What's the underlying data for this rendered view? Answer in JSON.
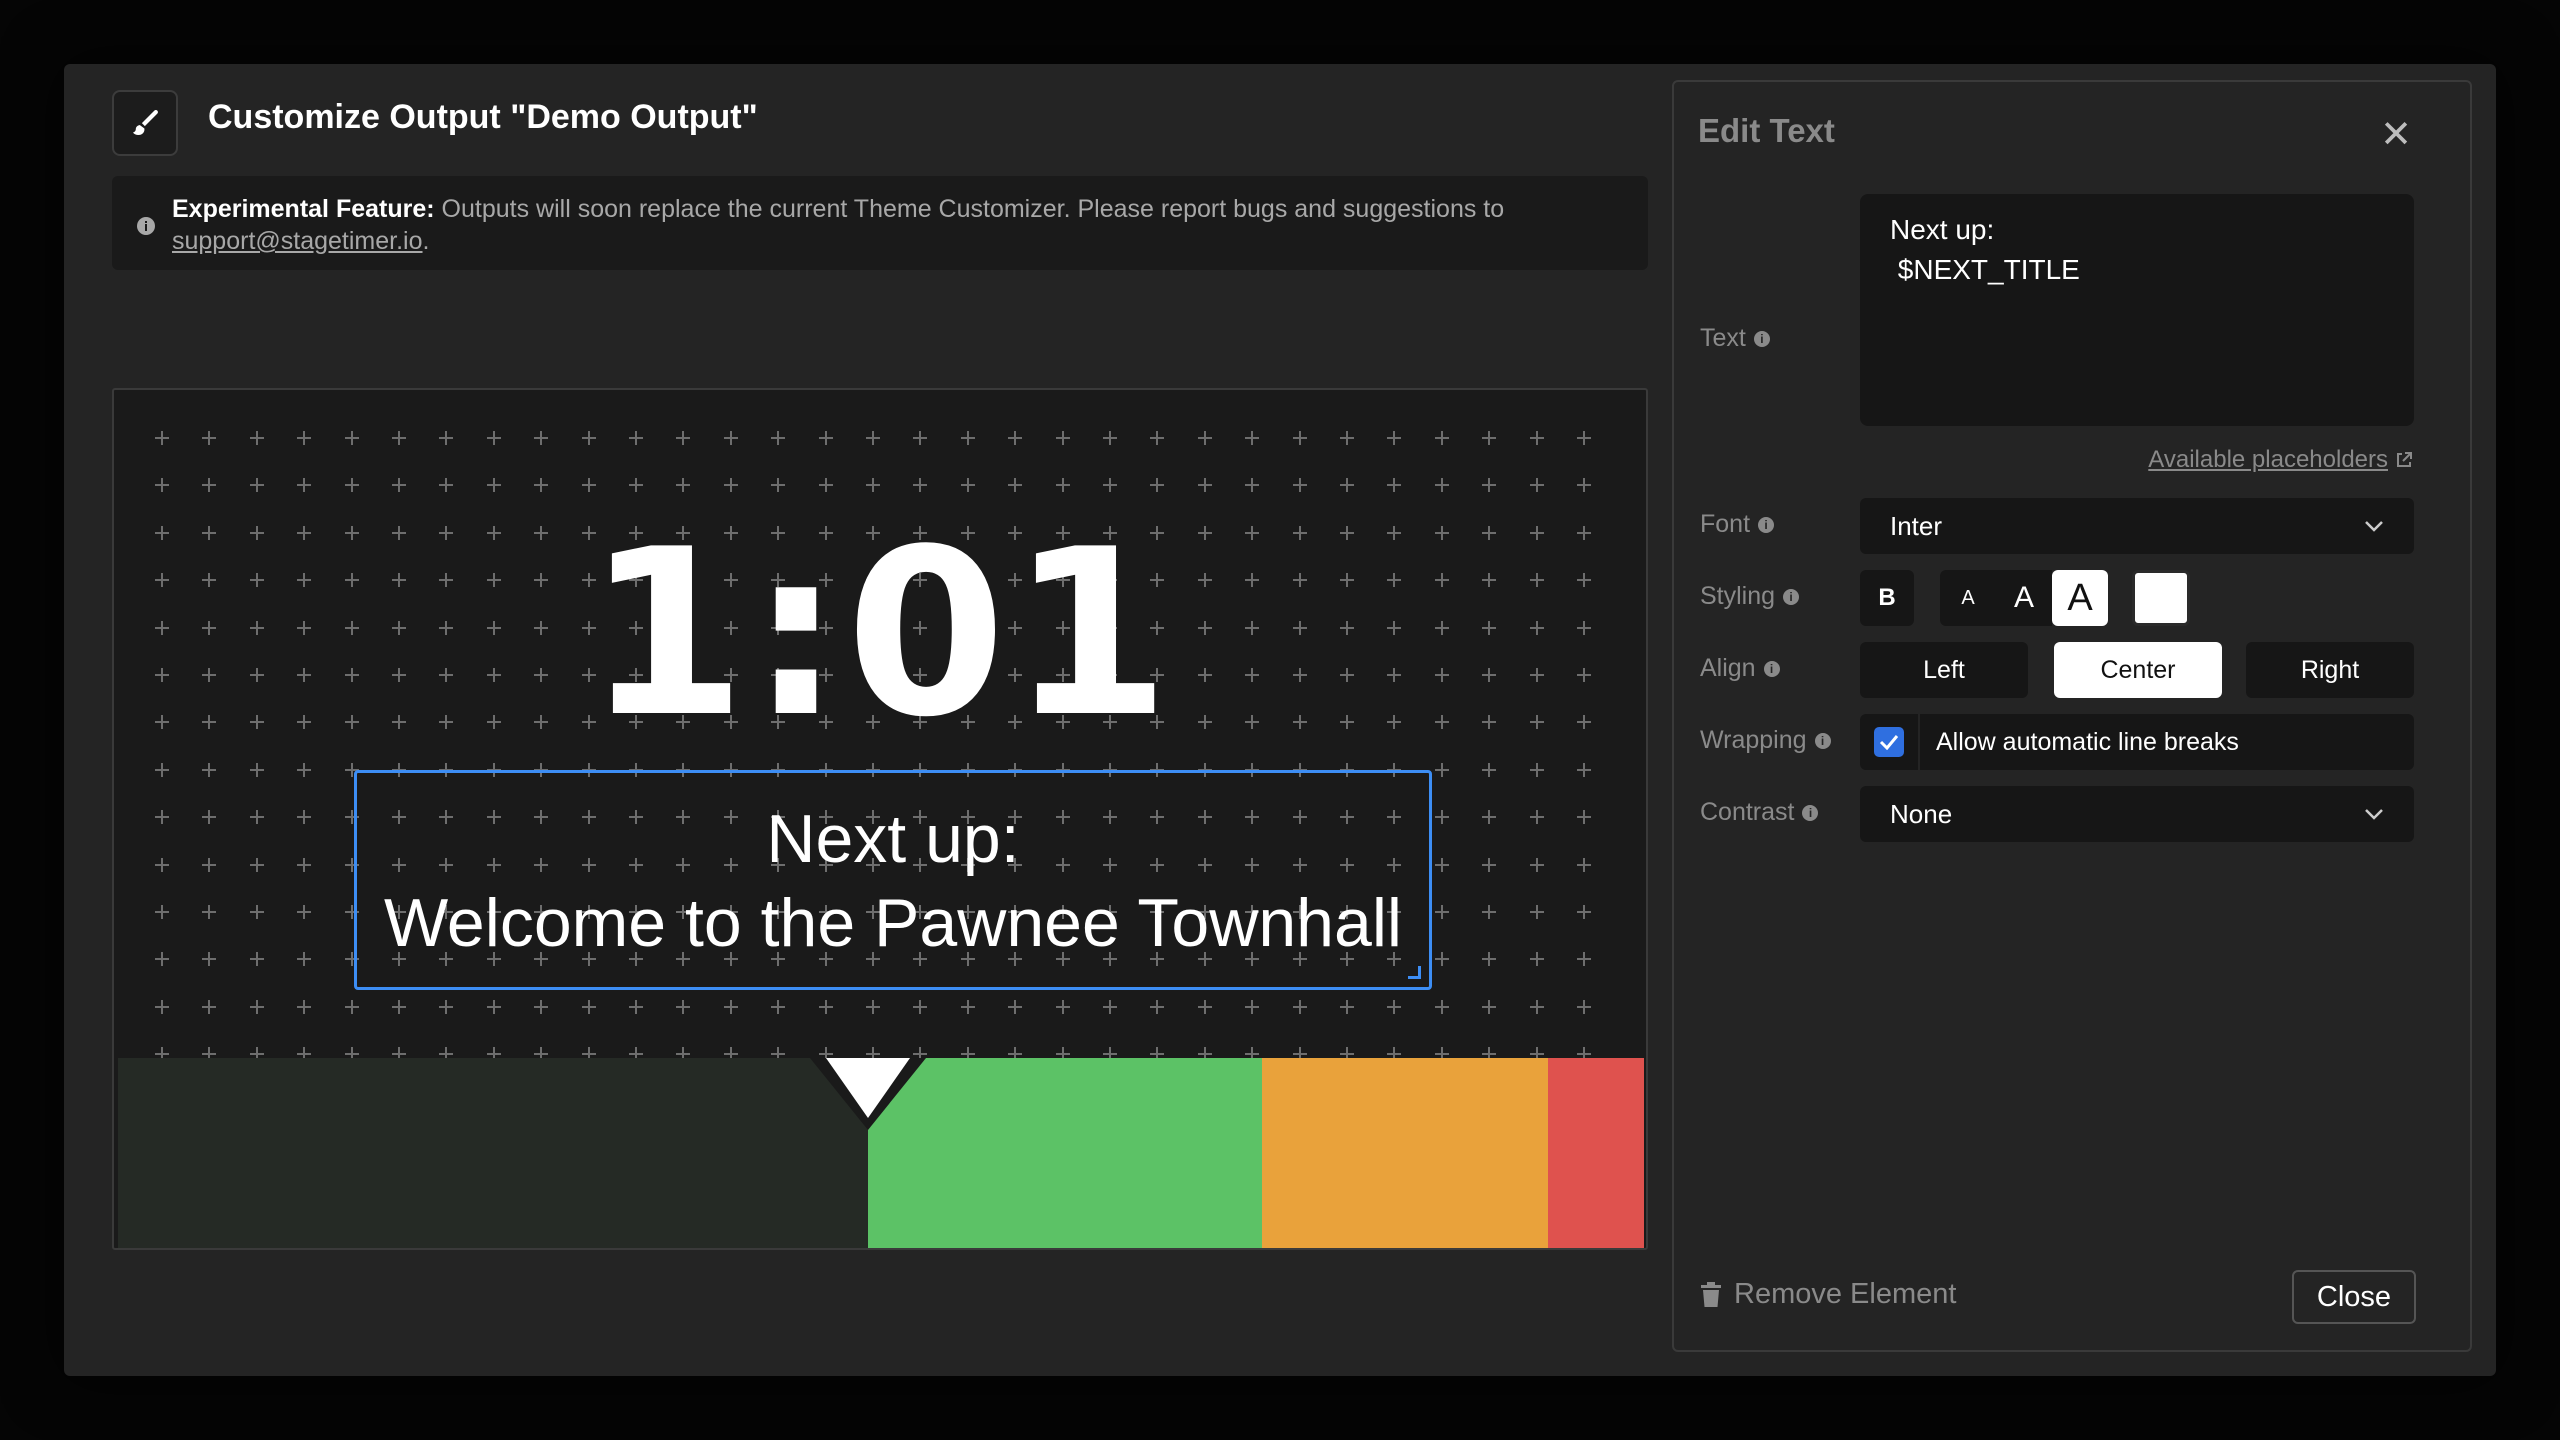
{
  "header": {
    "title": "Customize Output \"Demo Output\"",
    "icon": "paintbrush-icon"
  },
  "notice": {
    "label": "Experimental Feature:",
    "message": " Outputs will soon replace the current Theme Customizer. Please report bugs and suggestions to",
    "email": "support@stagetimer.io",
    "end": "."
  },
  "preview": {
    "timer": "1:01",
    "next_line1": "Next up:",
    "next_line2": "Welcome to the Pawnee Townhall",
    "progress_colors": {
      "track": "#252a25",
      "green": "#5cc266",
      "orange": "#e9a23b",
      "red": "#df524e"
    }
  },
  "edit_panel": {
    "title": "Edit Text",
    "text_label": "Text",
    "text_value": "Next up:\n $NEXT_TITLE",
    "placeholders_link": "Available placeholders",
    "font_label": "Font",
    "font_value": "Inter",
    "styling_label": "Styling",
    "bold_label": "B",
    "size_small": "A",
    "size_medium": "A",
    "size_large": "A",
    "align_label": "Align",
    "align_left": "Left",
    "align_center": "Center",
    "align_right": "Right",
    "wrapping_label": "Wrapping",
    "wrapping_text": "Allow automatic line breaks",
    "wrapping_checked": true,
    "contrast_label": "Contrast",
    "contrast_value": "None",
    "remove_label": "Remove Element",
    "close_label": "Close"
  },
  "colors": {
    "accent": "#3d8ef5",
    "checkbox": "#2f6fe0"
  }
}
